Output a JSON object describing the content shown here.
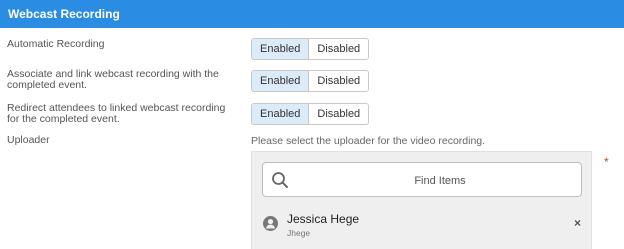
{
  "header": {
    "title": "Webcast Recording"
  },
  "settings": [
    {
      "label": "Automatic Recording",
      "enabled": "Enabled",
      "disabled": "Disabled"
    },
    {
      "label": "Associate and link webcast recording with the completed event.",
      "enabled": "Enabled",
      "disabled": "Disabled"
    },
    {
      "label": "Redirect attendees to linked webcast recording for the completed event.",
      "enabled": "Enabled",
      "disabled": "Disabled"
    }
  ],
  "uploader": {
    "label": "Uploader",
    "hint": "Please select the uploader for the video recording.",
    "required": "*",
    "search_placeholder": "Find Items",
    "selected": {
      "name": "Jessica Hege",
      "username": "Jhege"
    },
    "remove_glyph": "×"
  },
  "colors": {
    "header_bg": "#2b8ce3",
    "active_toggle_bg": "#dcebfa"
  }
}
